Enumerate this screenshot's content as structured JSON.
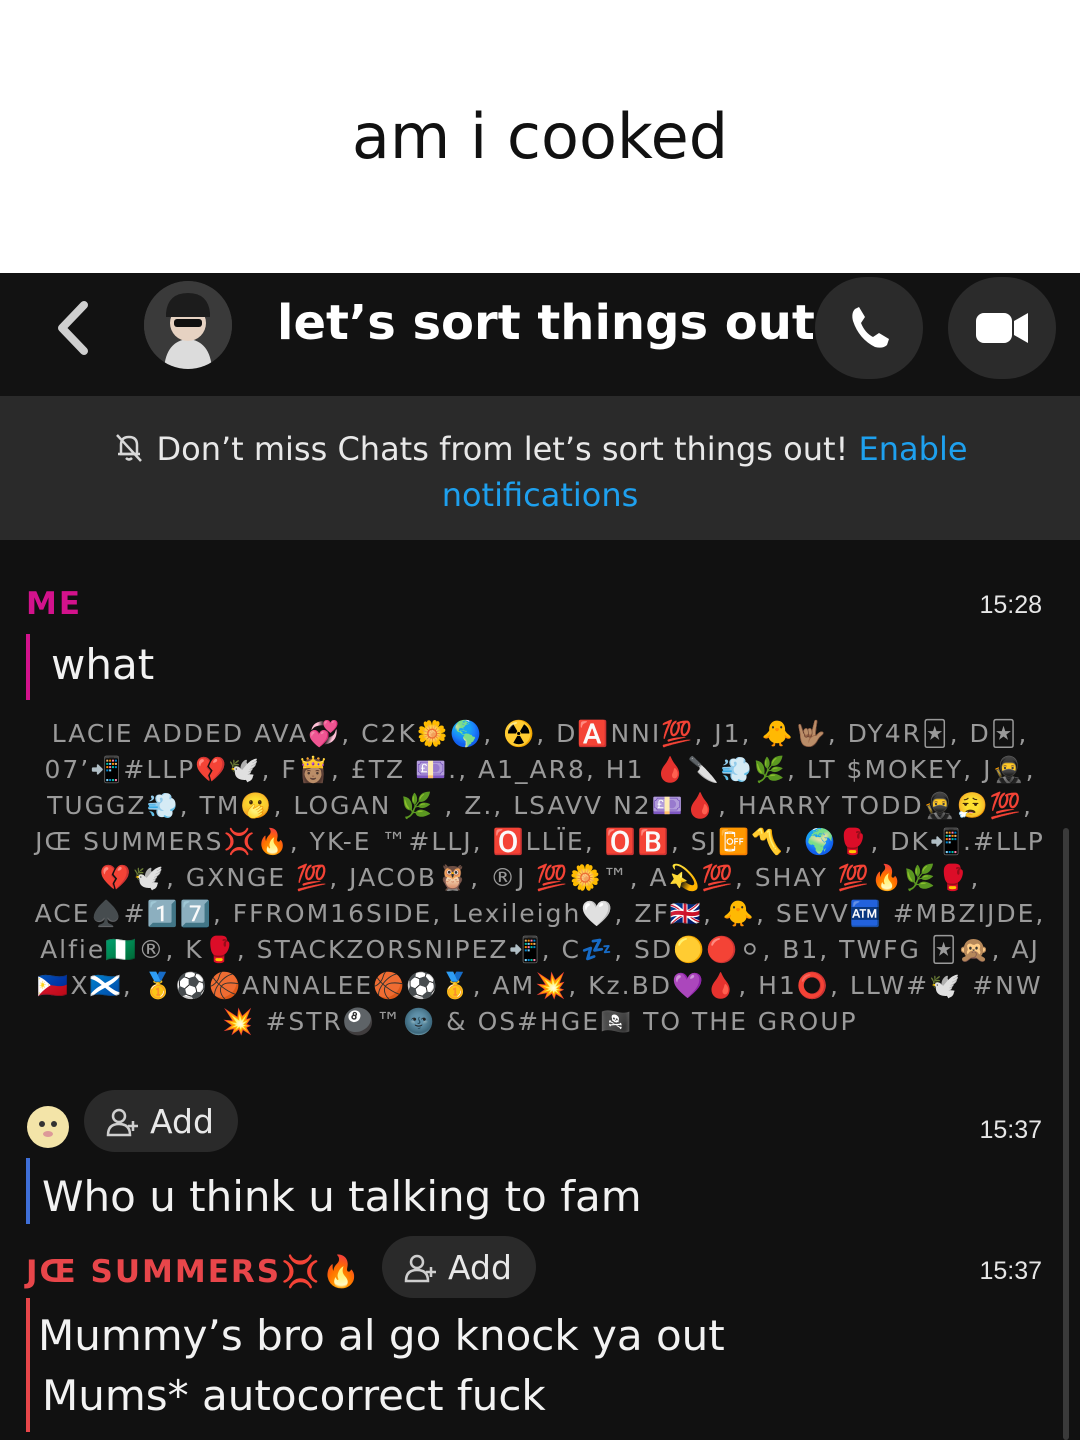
{
  "caption": "am i cooked",
  "header": {
    "title": "let’s sort things out",
    "back_icon": "chevron-left-icon",
    "call_icon": "phone-icon",
    "video_icon": "video-camera-icon"
  },
  "banner": {
    "text": "Don’t miss Chats from let’s sort things out!",
    "link_part1": "Enable",
    "link_part2": "notifications",
    "icon": "bell-off-icon"
  },
  "messages": [
    {
      "sender": "ME",
      "time": "15:28",
      "text": "what",
      "color": "#d3128c"
    },
    {
      "add_label": "Add",
      "time": "15:37",
      "text": "Who u think u talking to fam",
      "color": "#3f6fd8"
    },
    {
      "sender": "JŒ SUMMERS💢🔥",
      "add_label": "Add",
      "time": "15:37",
      "line1": "Mummy’s bro al go knock ya out",
      "line2": "Mums* autocorrect fuck",
      "color": "#e8464a"
    }
  ],
  "system_message": "LACIE ADDED AVA💞, C2K🌼🌎, ☢️, D🅰️NNI💯, J1, 🐥🤟🏽, DY4R🃏, D🃏, 07’📲#LLP💔🕊️, F👸🏽, £TZ 💷., A1_AR8, H1 🩸🔪💨🌿, LT $MOKEY, J🥷, TUGGZ💨, TM🫢, LOGAN 🌿 , Z., LSAVV N2💷🩸, HARRY TODD🥷😮‍💨💯, JŒ SUMMERS💢🔥, YK-E ™#LLJ, 🅾️LLÏE, 🅾️🅱️, SJ📴〽️, 🌍🥊, DK📲.#LLP💔🕊️, GXNGE 💯, JACOB🦉, ®J 💯🌼™, A💫💯, SHAY 💯🔥🌿🥊, ACE♠️#1️⃣7️⃣, FFROM16SIDE, Lexileigh🤍, ZF🇬🇧, 🐥, SEVV🏧 #MBZIJDE, Alfie🇳🇬®, K🥊, STACKZORSNIPEZ📲, C💤, SD🟡🔴⚪, B1, TWFG 🃏🙊, AJ 🇵🇭X🏴󠁧󠁢󠁳󠁣󠁴󠁿, 🥇⚽🏀ANNALEE🏀⚽🥇, AM💥, Kz.BD💜🩸, H1⭕, LLW#🕊️ #NW💥 #STR🎱™🌚 & OS#HGE🏴‍☠️ TO THE GROUP"
}
